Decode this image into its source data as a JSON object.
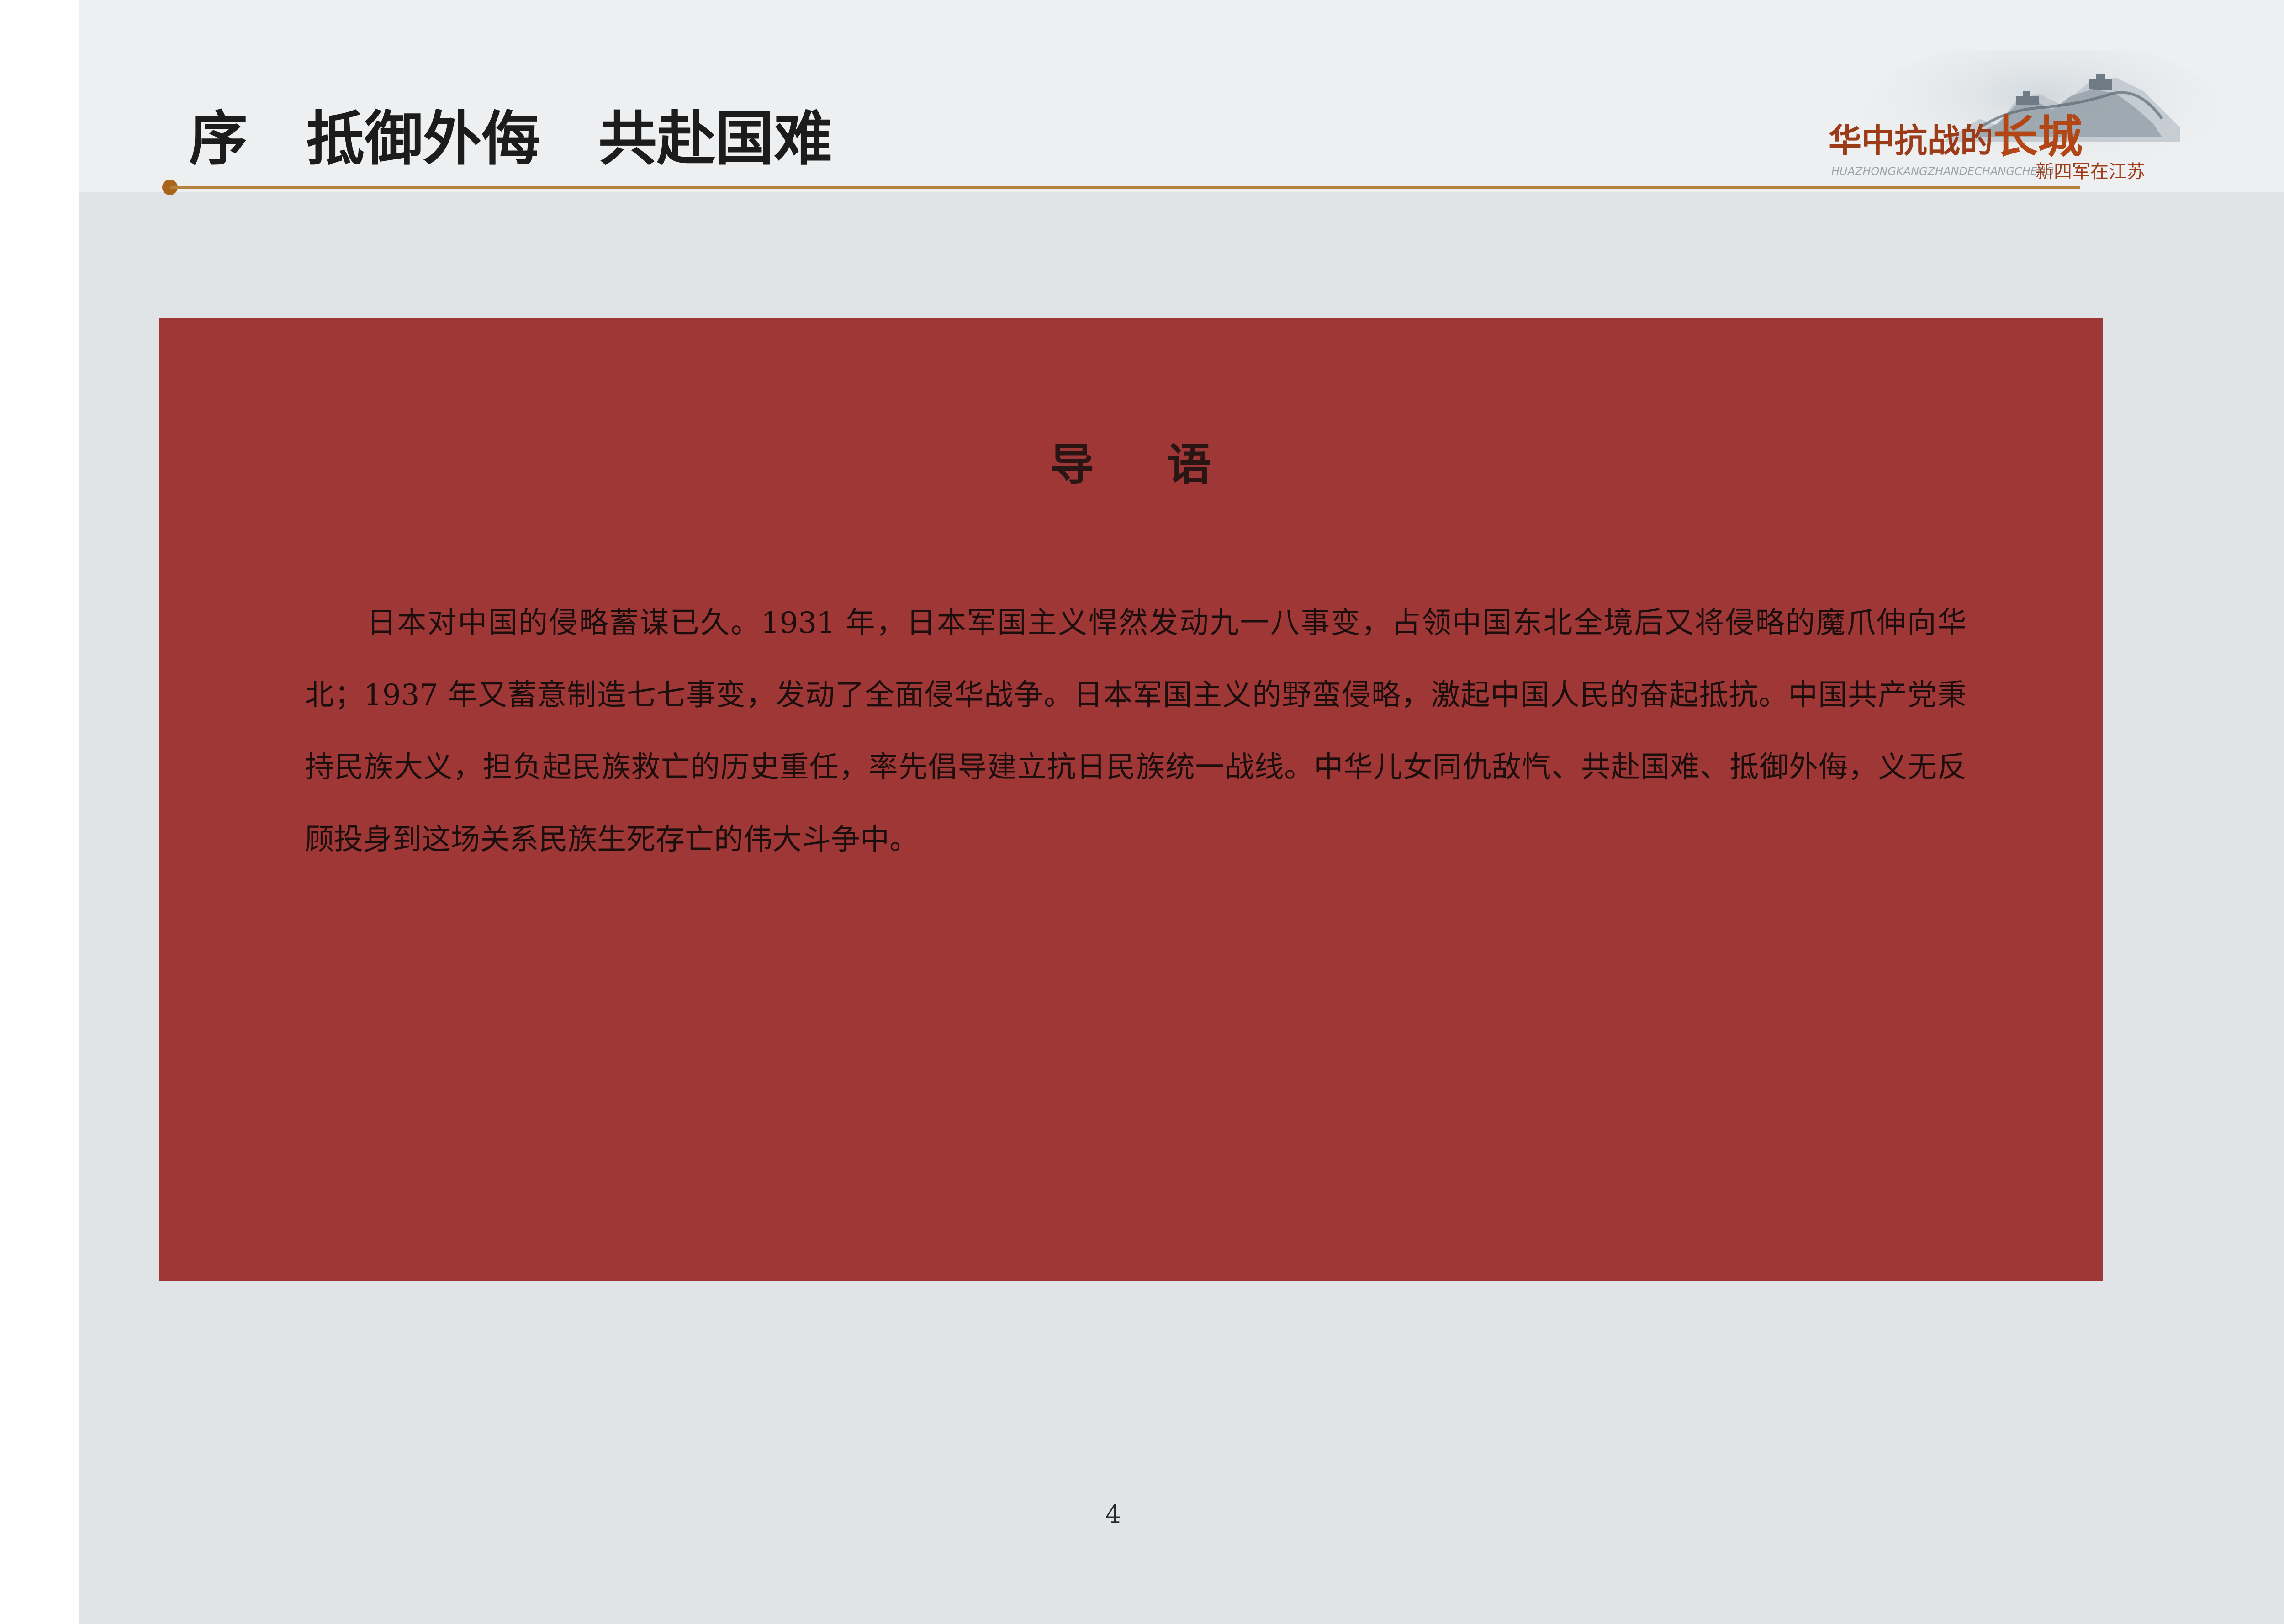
{
  "header": {
    "section_title": "序　抵御外侮　共赴国难",
    "logo": {
      "title_small": "华中抗战的",
      "title_big": "长城",
      "pinyin": "HUAZHONGKANGZHANDECHANGCHENG",
      "subtitle": "新四军在江苏",
      "art_icon": "great-wall-icon"
    }
  },
  "intro": {
    "heading": "导语",
    "body": "日本对中国的侵略蓄谋已久。1931 年，日本军国主义悍然发动九一八事变，占领中国东北全境后又将侵略的魔爪伸向华北；1937 年又蓄意制造七七事变，发动了全面侵华战争。日本军国主义的野蛮侵略，激起中国人民的奋起抵抗。中国共产党秉持民族大义，担负起民族救亡的历史重任，率先倡导建立抗日民族统一战线。中华儿女同仇敌忾、共赴国难、抵御外侮，义无反顾投身到这场关系民族生死存亡的伟大斗争中。"
  },
  "footer": {
    "page_number": "4"
  },
  "colors": {
    "page_background": "#e1e4e7",
    "header_band": "#edeff0",
    "intro_box": "#9e3736",
    "accent_rule": "#b5813d",
    "logo_text": "#9c3b17"
  }
}
